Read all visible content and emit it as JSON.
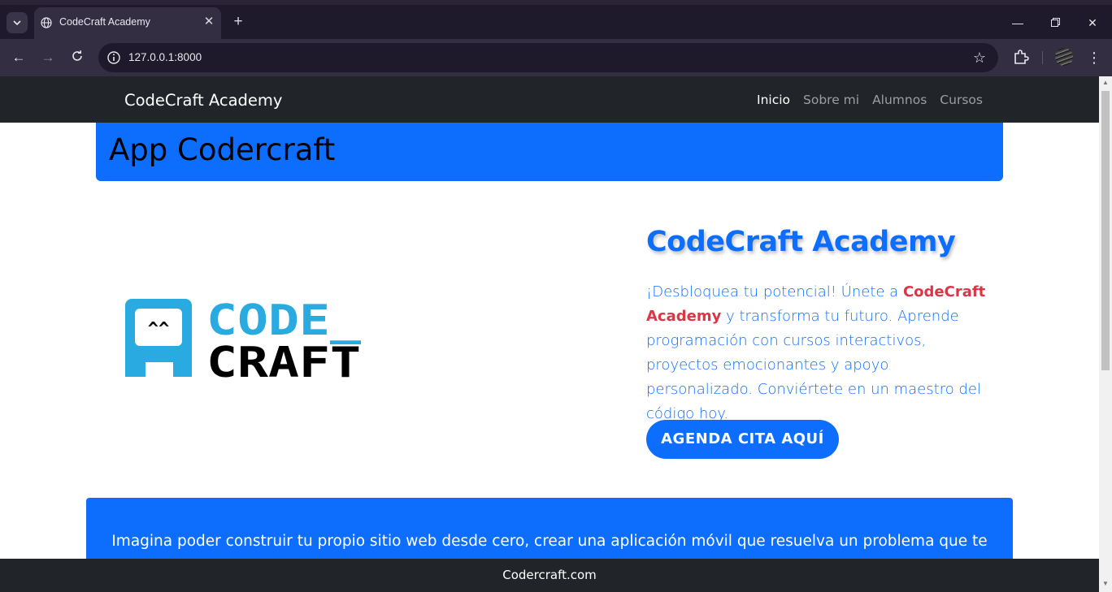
{
  "browser": {
    "tab_title": "CodeCraft Academy",
    "url": "127.0.0.1:8000",
    "icons": {
      "tab_search": "chevron-down-icon",
      "tab_favicon": "globe-icon",
      "tab_close": "close-icon",
      "new_tab": "plus-icon",
      "back": "arrow-left-icon",
      "forward": "arrow-right-icon",
      "reload": "reload-icon",
      "site_info": "info-icon",
      "bookmark": "star-icon",
      "extensions": "puzzle-icon",
      "profile": "avatar",
      "menu": "kebab-menu-icon"
    }
  },
  "site": {
    "brand": "CodeCraft Academy",
    "nav": [
      {
        "label": "Inicio",
        "active": true
      },
      {
        "label": "Sobre mi",
        "active": false
      },
      {
        "label": "Alumnos",
        "active": false
      },
      {
        "label": "Cursos",
        "active": false
      }
    ],
    "page_title": "App Codercraft",
    "logo": {
      "line1": "CODE_",
      "line2": "CRAFT",
      "face": "^^"
    },
    "hero": {
      "heading": "CodeCraft Academy",
      "desc_before": "¡Desbloquea tu potencial! Únete a ",
      "desc_highlight": "CodeCraft Academy",
      "desc_after": " y transforma tu futuro. Aprende programación con cursos interactivos, proyectos emocionantes y apoyo personalizado. Conviértete en un maestro del código hoy.",
      "cta": "AGENDA CITA AQUÍ"
    },
    "info_text": "Imagina poder construir tu propio sitio web desde cero, crear una aplicación móvil que resuelva un problema que te",
    "footer": "Codercraft.com"
  },
  "colors": {
    "primary": "#0d6efd",
    "navbar": "#212529",
    "highlight": "#dc3545",
    "logo_blue": "#29abe2"
  }
}
